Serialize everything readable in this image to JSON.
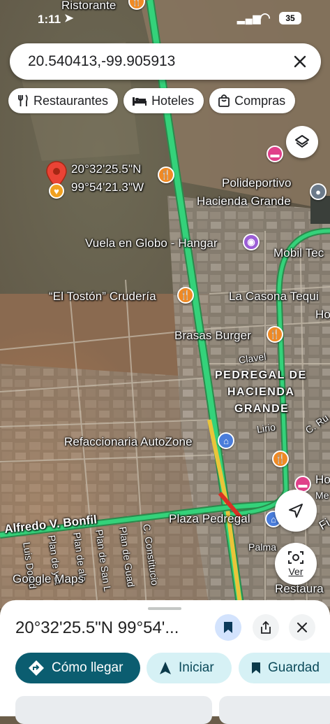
{
  "status_bar": {
    "time": "1:11",
    "battery": "35"
  },
  "search": {
    "value": "20.540413,-99.905913"
  },
  "chips": [
    {
      "label": "Restaurantes",
      "icon": "fork-knife-icon"
    },
    {
      "label": "Hoteles",
      "icon": "bed-icon"
    },
    {
      "label": "Compras",
      "icon": "shopping-bag-icon"
    }
  ],
  "map": {
    "pin_label_line1": "20°32'25.5\"N",
    "pin_label_line2": "99°54'21.3\"W",
    "labels": {
      "ristorante": "Ristorante",
      "polideportivo1": "Polideportivo",
      "polideportivo2": "Hacienda Grande",
      "vuela": "Vuela en Globo - Hangar",
      "mobil": "Mobil Tec",
      "toston": "“El Tostón” Crudería",
      "casona": "La Casona Tequi",
      "ho1": "Ho",
      "brasas": "Brasas Burger",
      "clavel": "Clavel",
      "pedregal1": "PEDREGAL DE",
      "pedregal2": "HACIENDA",
      "pedregal3": "GRANDE",
      "lirio": "Lirio",
      "cru": "C. Ru",
      "autozone": "Refaccionaria AutoZone",
      "ho2": "Ho",
      "me": "Me",
      "alfredo": "Alfredo V. Bonfil",
      "plaza": "Plaza Pedregal",
      "fi": "Fi",
      "palma": "Palma",
      "restaura": "Restaura",
      "luis": "Luis Doald",
      "plan_yut": "Plan de yut",
      "plan_ala": "Plan de ala",
      "plan_san": "Plan de San L",
      "plan_gua": "Plan de Guad",
      "constitucion": "C. Constitucio"
    },
    "watermark": "Google Maps",
    "ver_label": "Ver"
  },
  "sheet": {
    "title": "20°32'25.5\"N 99°54'...",
    "directions_label": "Cómo llegar",
    "start_label": "Iniciar",
    "save_label": "Guardad"
  },
  "colors": {
    "accent": "#0b57d0",
    "directions_bg": "#0b5d70",
    "chip_bg": "#ffffff",
    "road_green": "#34d27a",
    "pin_red": "#ea4335",
    "restaurant_orange": "#f08a24"
  }
}
